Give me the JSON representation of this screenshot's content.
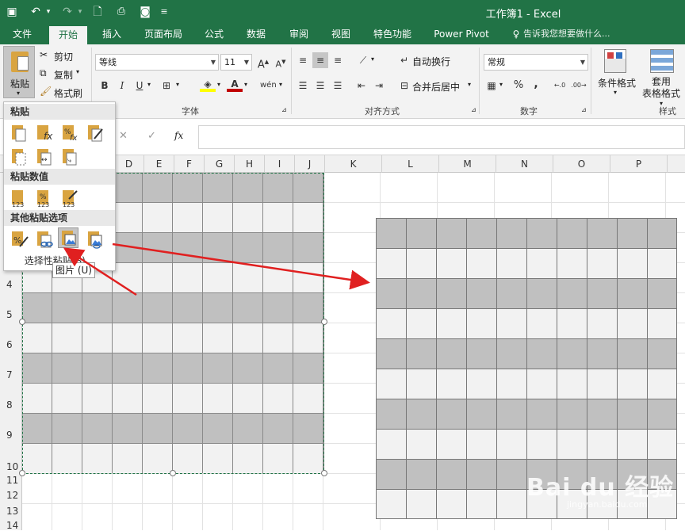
{
  "titlebar": {
    "title": "工作簿1 - Excel",
    "bg_color": "#217346",
    "quick_access": [
      {
        "icon": "save-icon",
        "glyph": "💾"
      },
      {
        "icon": "undo-icon",
        "glyph": "↶"
      },
      {
        "icon": "redo-icon",
        "glyph": "↷"
      },
      {
        "icon": "new-file-icon",
        "glyph": "🗋"
      },
      {
        "icon": "print-preview-icon",
        "glyph": "🔍"
      },
      {
        "icon": "camera-icon",
        "glyph": "📷"
      },
      {
        "icon": "customize-icon",
        "glyph": "="
      }
    ]
  },
  "tabs": [
    "文件",
    "开始",
    "插入",
    "页面布局",
    "公式",
    "数据",
    "审阅",
    "视图",
    "特色功能",
    "Power Pivot"
  ],
  "active_tab": "开始",
  "tell_me": {
    "icon": "lightbulb-icon",
    "placeholder": "告诉我您想要做什么..."
  },
  "clipboard": {
    "paste": "粘贴",
    "cut": "剪切",
    "copy": "复制",
    "format_painter": "格式刷"
  },
  "font": {
    "name": "等线",
    "size": "11",
    "group_label": "字体",
    "bold": "B",
    "italic": "I",
    "underline": "U",
    "font_color": "#c00000",
    "fill_color": "#ffff00"
  },
  "alignment": {
    "wrap": "自动换行",
    "merge": "合并后居中",
    "group_label": "对齐方式"
  },
  "number": {
    "format": "常规",
    "group_label": "数字",
    "percent": "%",
    "comma": ","
  },
  "styles": {
    "conditional": "条件格式",
    "table_format": "套用\n表格格式",
    "group_label": "样式"
  },
  "formula_bar": {
    "fx": "fx"
  },
  "columns_left": [
    "D",
    "E",
    "F",
    "G",
    "H",
    "I",
    "J"
  ],
  "columns_right": [
    "K",
    "L",
    "M",
    "N",
    "O",
    "P"
  ],
  "rows": [
    "4",
    "5",
    "6",
    "7",
    "8",
    "9",
    "10",
    "11",
    "12",
    "13",
    "14"
  ],
  "paste_menu": {
    "section1": "粘贴",
    "section2": "粘贴数值",
    "section3": "其他粘贴选项",
    "footer": "选择性粘贴(S)...",
    "tooltip": "图片 (U)",
    "paste_icons": [
      "paste-icon",
      "paste-formulas-icon",
      "paste-formulas-number-format-icon",
      "paste-keep-source-format-icon",
      "paste-no-borders-icon",
      "paste-keep-column-width-icon",
      "paste-transpose-icon"
    ],
    "value_icons": [
      "paste-values-icon",
      "paste-values-number-format-icon",
      "paste-values-source-format-icon"
    ],
    "other_icons": [
      "paste-formatting-icon",
      "paste-link-icon",
      "paste-picture-icon",
      "paste-linked-picture-icon"
    ]
  },
  "colors": {
    "accent": "#217346",
    "band_dark": "#c0c0c0",
    "band_light": "#f2f2f2",
    "arrow": "#e02020"
  },
  "watermark": {
    "logo": "Bai du 经验",
    "sub": "jingyan.baidu.com"
  }
}
